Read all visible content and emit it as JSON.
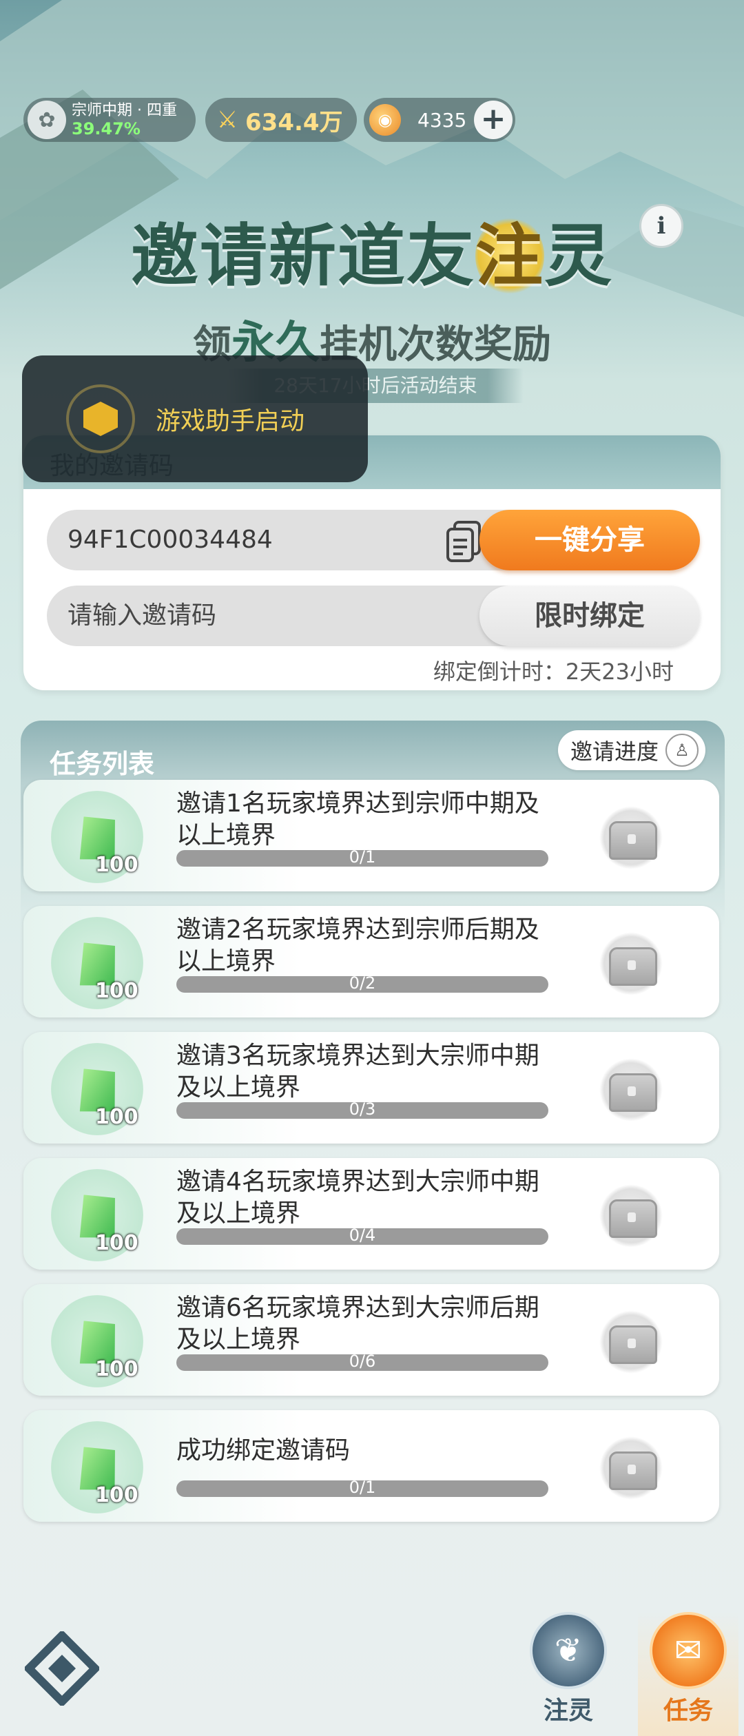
{
  "topbar": {
    "rank_name": "宗师中期 · 四重",
    "rank_percent": "39.47%",
    "power": "634.4万",
    "spirit_stones": "4335",
    "add_label": "+"
  },
  "header": {
    "title_pre": "邀请新道友",
    "title_hl": "注",
    "title_post": "灵",
    "info_label": "i",
    "subtitle_pre": "领",
    "subtitle_accent": "永久",
    "subtitle_post": "挂机次数奖励",
    "countdown": "28天17小时后活动结束"
  },
  "toast": {
    "text": "游戏助手启动"
  },
  "invite": {
    "header": "我的邀请码",
    "code": "94F1C00034484",
    "share_label": "一键分享",
    "input_placeholder": "请输入邀请码",
    "bind_label": "限时绑定",
    "bind_countdown": "绑定倒计时：2天23小时"
  },
  "tasks": {
    "title": "任务列表",
    "progress_label": "邀请进度",
    "items": [
      {
        "desc": "邀请1名玩家境界达到宗师中期及以上境界",
        "reward": "100",
        "progress_text": "0/1",
        "progress": 0
      },
      {
        "desc": "邀请2名玩家境界达到宗师后期及以上境界",
        "reward": "100",
        "progress_text": "0/2",
        "progress": 0
      },
      {
        "desc": "邀请3名玩家境界达到大宗师中期及以上境界",
        "reward": "100",
        "progress_text": "0/3",
        "progress": 0
      },
      {
        "desc": "邀请4名玩家境界达到大宗师中期及以上境界",
        "reward": "100",
        "progress_text": "0/4",
        "progress": 0
      },
      {
        "desc": "邀请6名玩家境界达到大宗师后期及以上境界",
        "reward": "100",
        "progress_text": "0/6",
        "progress": 0
      },
      {
        "desc": "成功绑定邀请码",
        "reward": "100",
        "progress_text": "0/1",
        "progress": 0
      }
    ]
  },
  "nav": {
    "zhuling_label": "注灵",
    "task_label": "任务"
  },
  "colors": {
    "accent_orange": "#f07a1e",
    "title_green": "#2d5a4d",
    "toast_text": "#f1cf55"
  }
}
